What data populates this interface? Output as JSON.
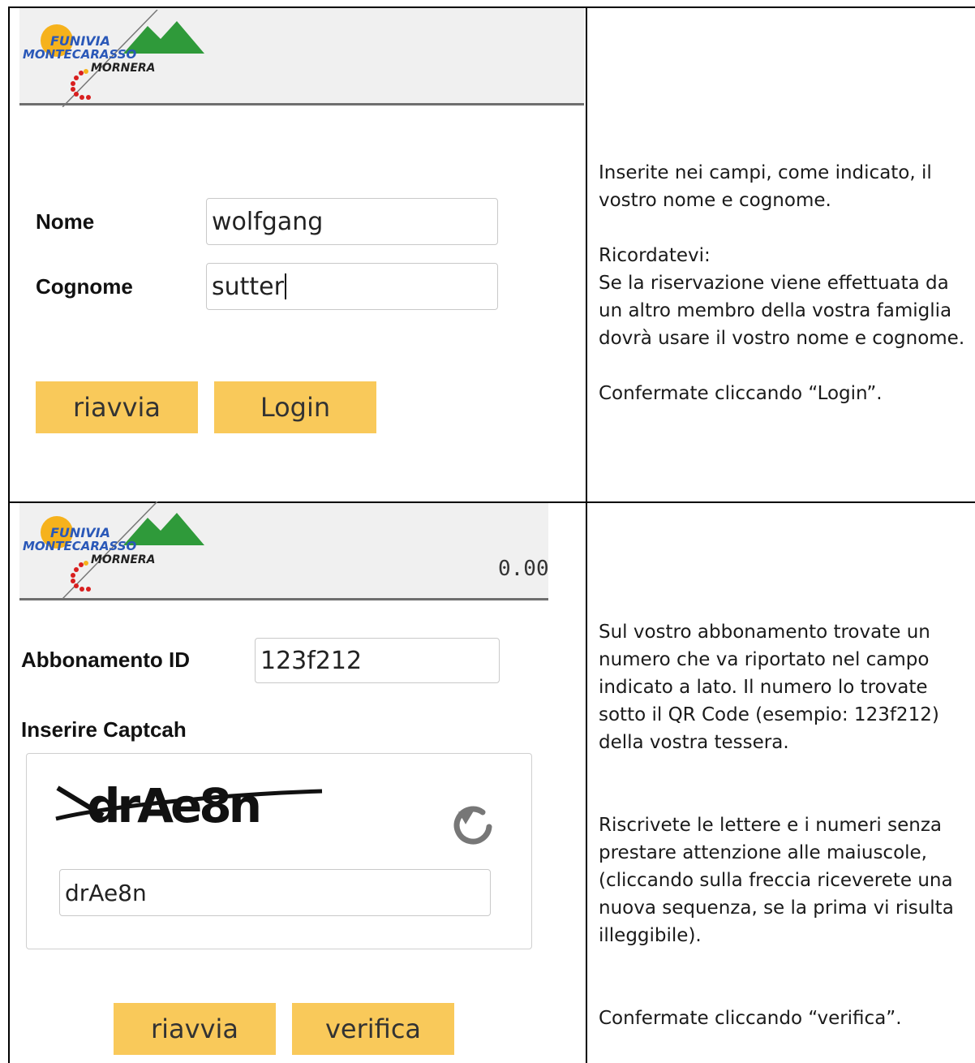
{
  "section1": {
    "logo": {
      "name": "funivia-monte-carasso-mornera-logo",
      "line1": "FUNIVIA",
      "line2": "MONTECARASSO",
      "line3": "MORNERA"
    },
    "form": {
      "nome_label": "Nome",
      "nome_value": "wolfgang",
      "cognome_label": "Cognome",
      "cognome_value": "sutter"
    },
    "buttons": {
      "restart": "riavvia",
      "login": "Login"
    },
    "instructions": {
      "p1": "Inserite nei campi, come indicato, il vostro nome e cognome.",
      "p2": "Ricordatevi:",
      "p3": "Se la riservazione viene effettuata da un altro membro della vostra famiglia dovrà usare il vostro nome e cognome.",
      "p4": "Confermate cliccando “Login”."
    }
  },
  "section2": {
    "logo": {
      "name": "funivia-monte-carasso-mornera-logo",
      "line1": "FUNIVIA",
      "line2": "MONTECARASSO",
      "line3": "MORNERA"
    },
    "balance": "0.00",
    "form": {
      "abbonamento_label": "Abbonamento ID",
      "abbonamento_value": "123f212",
      "captcha_label": "Inserire Captcah",
      "captcha_image_text": "drAe8n",
      "captcha_value": "drAe8n"
    },
    "buttons": {
      "restart": "riavvia",
      "verify": "verifica"
    },
    "instructions": {
      "p1": "Sul vostro abbonamento trovate un numero che va riportato nel campo indicato a lato. Il numero lo trovate sotto il QR Code (esempio: 123f212) della vostra tessera.",
      "p2": "Riscrivete le lettere e i numeri senza prestare attenzione alle maiuscole, (cliccando sulla freccia riceverete una nuova sequenza, se la prima vi risulta illeggibile).",
      "p3": "Confermate cliccando “verifica”."
    }
  },
  "colors": {
    "button": "#f9c95a",
    "header_bg": "#f0f0f0",
    "header_rule": "#6e6e6e"
  }
}
